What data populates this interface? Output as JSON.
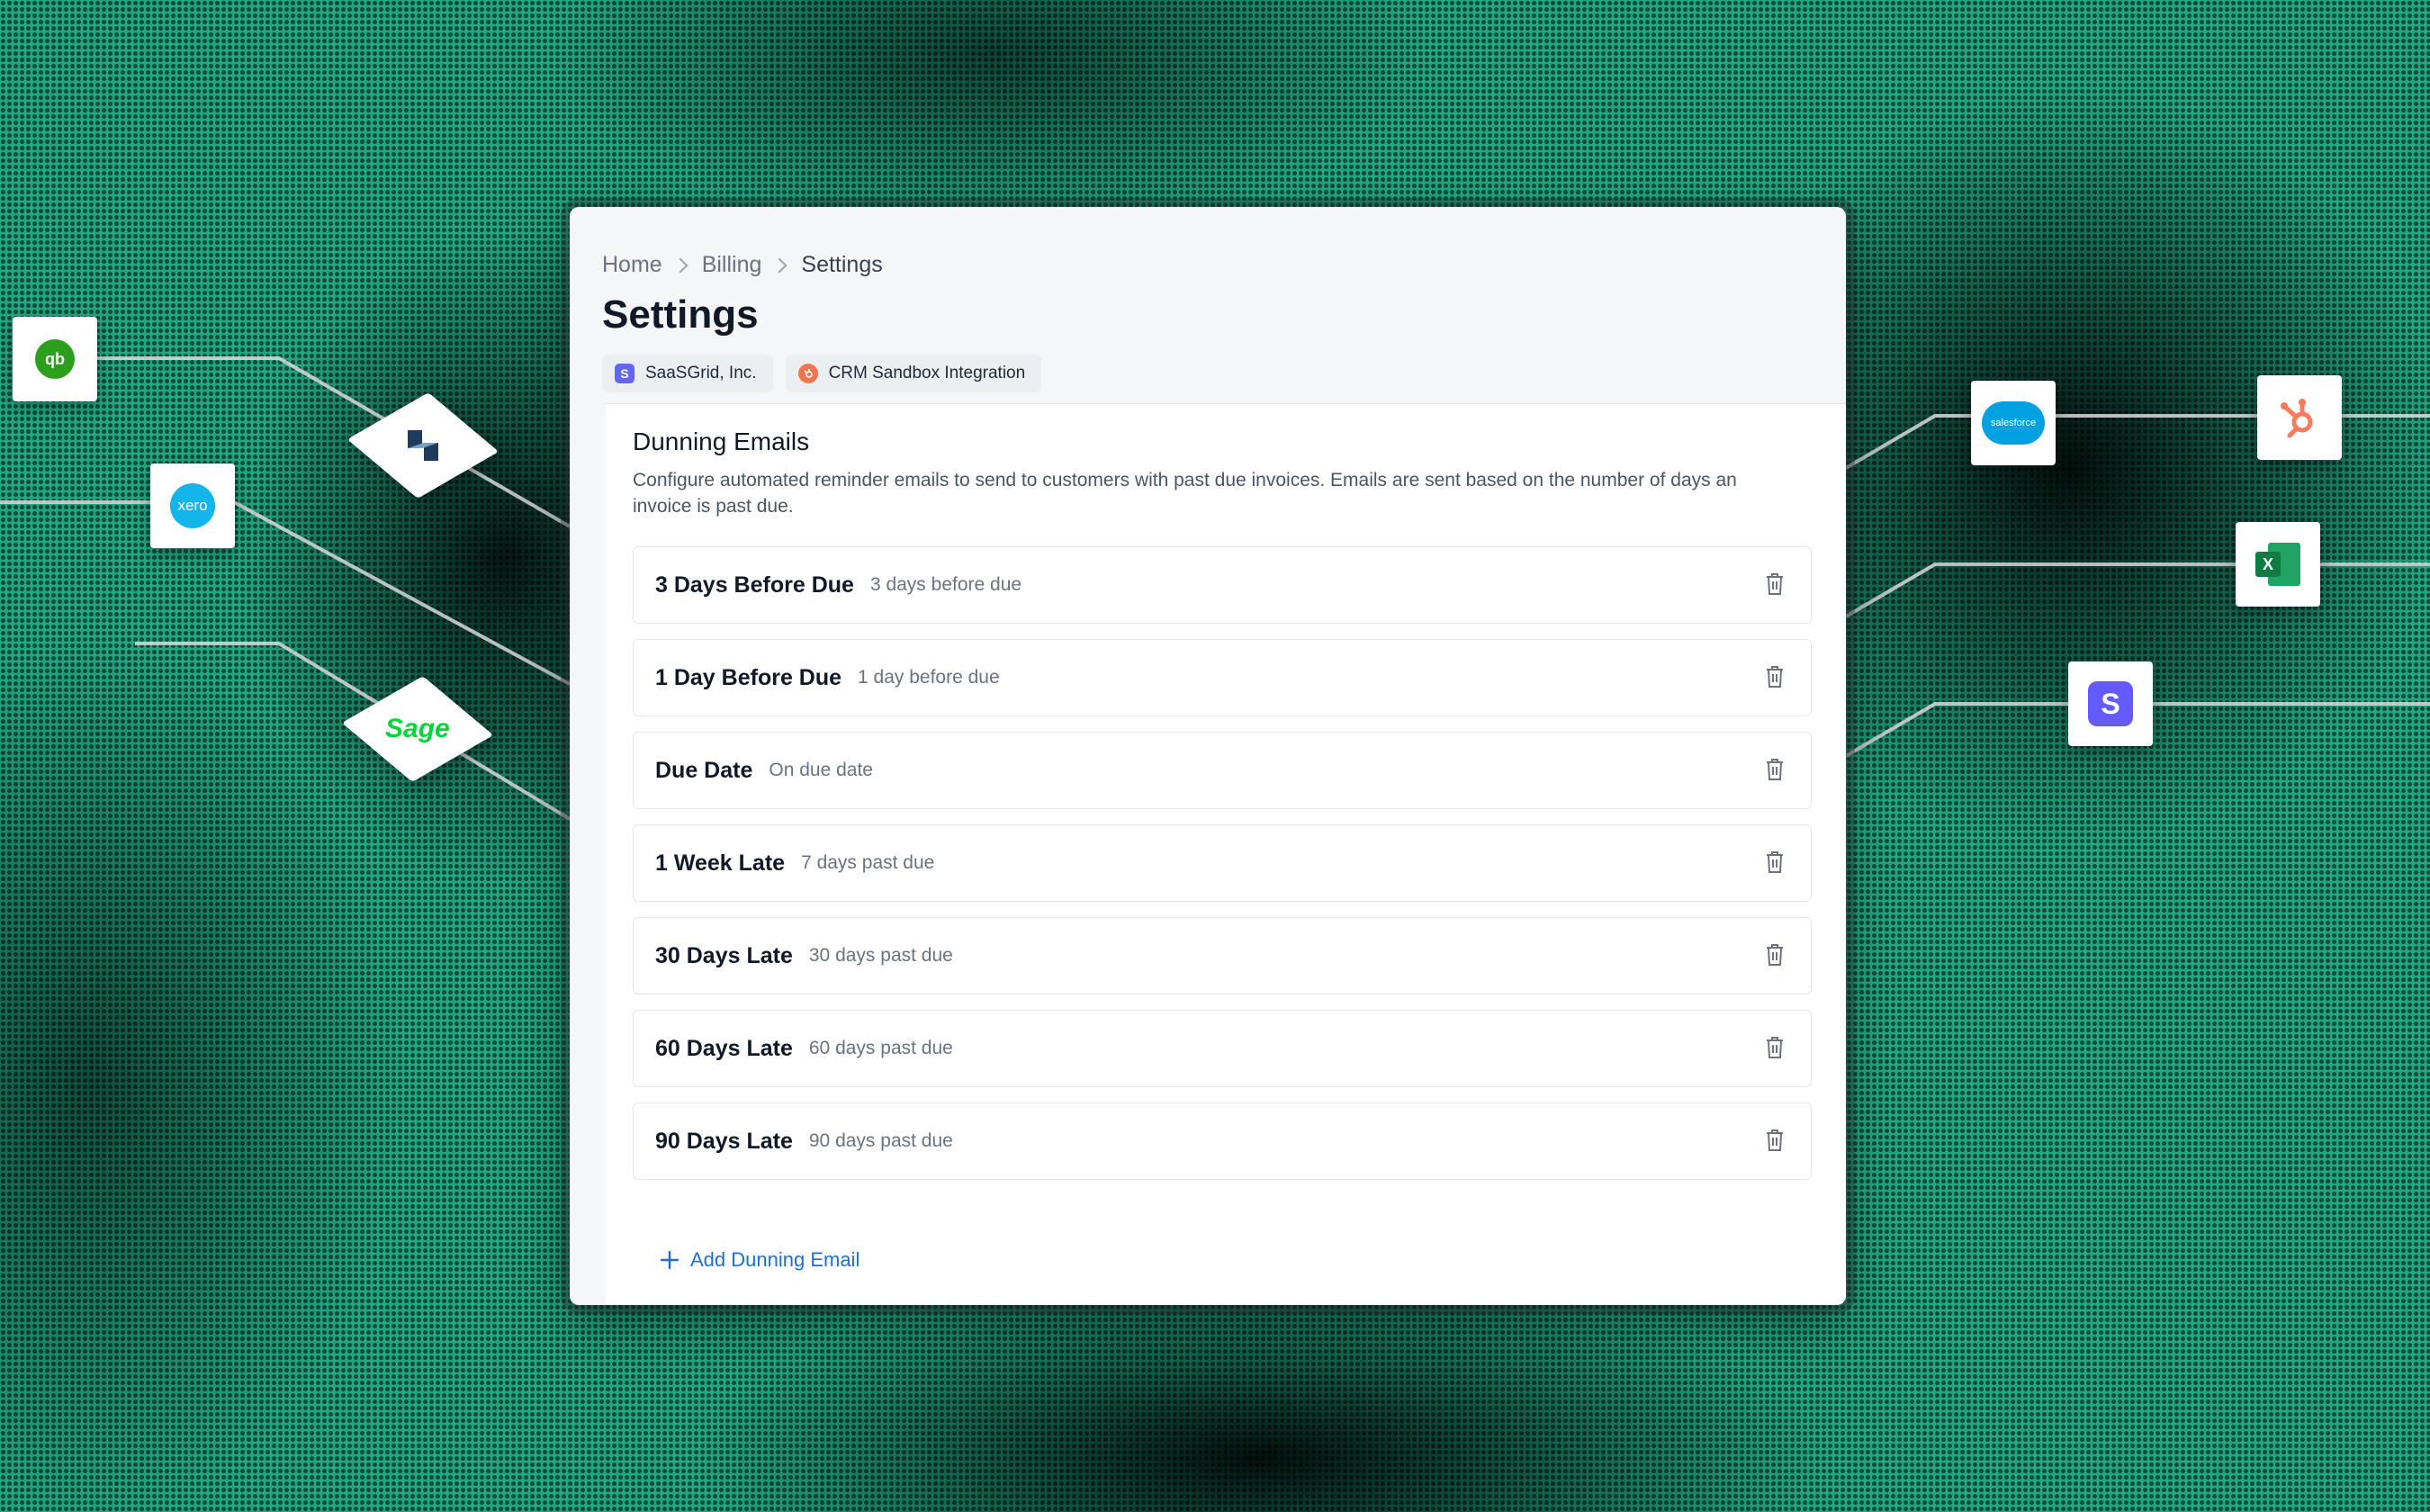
{
  "breadcrumb": [
    "Home",
    "Billing",
    "Settings"
  ],
  "page_title": "Settings",
  "chips": [
    {
      "label": "SaaSGrid, Inc.",
      "icon": "S",
      "color": "#6366f1"
    },
    {
      "label": "CRM Sandbox Integration",
      "icon": "hubspot-icon",
      "color": "#f2754f"
    }
  ],
  "dunning": {
    "title": "Dunning Emails",
    "description": "Configure automated reminder emails to send to customers with past due invoices. Emails are sent based on the number of days an invoice is past due.",
    "items": [
      {
        "name": "3 Days Before Due",
        "detail": "3 days before due"
      },
      {
        "name": "1 Day Before Due",
        "detail": "1 day before due"
      },
      {
        "name": "Due Date",
        "detail": "On due date"
      },
      {
        "name": "1 Week Late",
        "detail": "7 days past due"
      },
      {
        "name": "30 Days Late",
        "detail": "30 days past due"
      },
      {
        "name": "60 Days Late",
        "detail": "60 days past due"
      },
      {
        "name": "90 Days Late",
        "detail": "90 days past due"
      }
    ],
    "add_label": "Add Dunning Email"
  },
  "logos": {
    "quickbooks": "qb",
    "xero": "xero",
    "sage": "Sage",
    "salesforce": "salesforce",
    "excel": "X",
    "stripe": "S"
  },
  "colors": {
    "accent_link": "#1d6fd6",
    "background": "#21a882",
    "quickbooks": "#2ca01c",
    "xero": "#13b5ea",
    "sage": "#00d639",
    "salesforce": "#00a1e0",
    "hubspot": "#ff7a59",
    "excel": "#1d6f42",
    "stripe": "#635bff"
  }
}
